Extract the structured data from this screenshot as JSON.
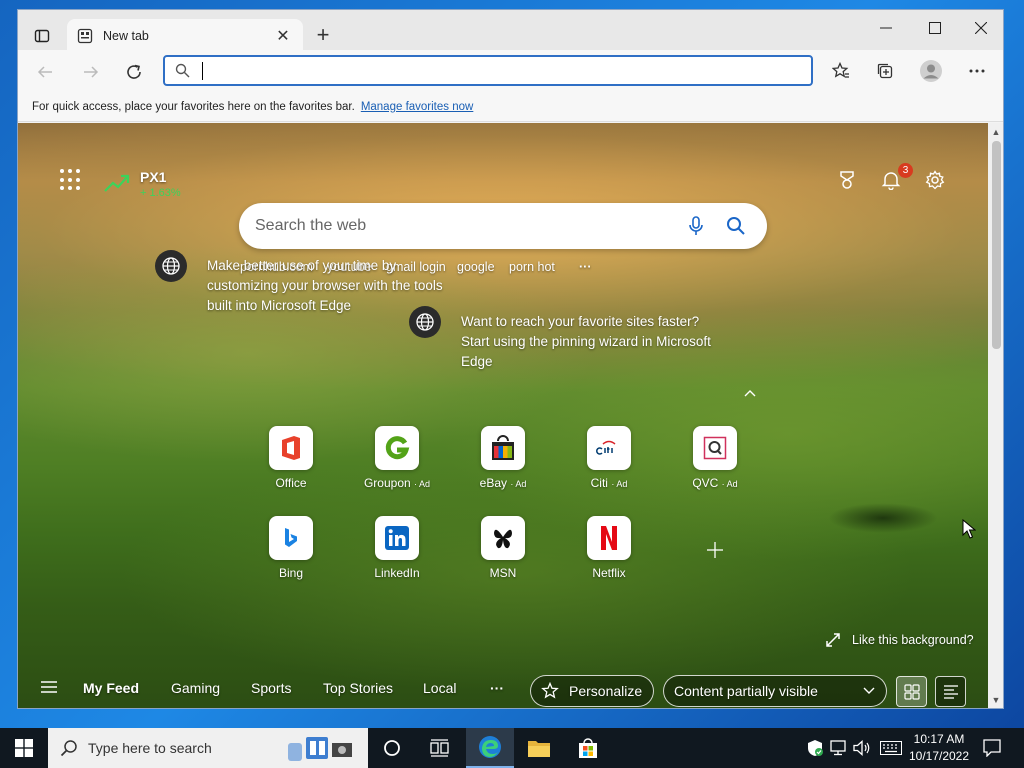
{
  "browser": {
    "tab_title": "New tab",
    "tab_close": "✕",
    "new_tab": "+",
    "address_value": "",
    "favbar_text": "For quick access, place your favorites here on the favorites bar.",
    "favbar_link": "Manage favorites now"
  },
  "newtab": {
    "stock_name": "PX1",
    "stock_change": "+ 1.63%",
    "notification_count": "3",
    "search_placeholder": "Search the web",
    "trending": [
      "pornhub.com",
      "youtube",
      "gmail login",
      "google",
      "porn hot",
      "···"
    ],
    "tip1": "Make better use of your time by customizing your browser with the tools built into Microsoft Edge",
    "tip2": "Want to reach your favorite sites faster? Start using the pinning wizard in Microsoft Edge",
    "tiles": [
      {
        "label": "Office",
        "ad": ""
      },
      {
        "label": "Groupon",
        "ad": "· Ad"
      },
      {
        "label": "eBay",
        "ad": "· Ad"
      },
      {
        "label": "Citi",
        "ad": "· Ad"
      },
      {
        "label": "QVC",
        "ad": "· Ad"
      },
      {
        "label": "Bing",
        "ad": ""
      },
      {
        "label": "LinkedIn",
        "ad": ""
      },
      {
        "label": "MSN",
        "ad": ""
      },
      {
        "label": "Netflix",
        "ad": ""
      }
    ],
    "like_background": "Like this background?",
    "feed": {
      "items": [
        "My Feed",
        "Gaming",
        "Sports",
        "Top Stories",
        "Local",
        "···"
      ],
      "personalize": "Personalize",
      "content_visibility": "Content partially visible"
    }
  },
  "taskbar": {
    "search_placeholder": "Type here to search",
    "time": "10:17 AM",
    "date": "10/17/2022"
  },
  "colors": {
    "edge_blue": "#2f6fc5",
    "stock_green": "#3cd35a",
    "badge_red": "#d83b1f"
  }
}
